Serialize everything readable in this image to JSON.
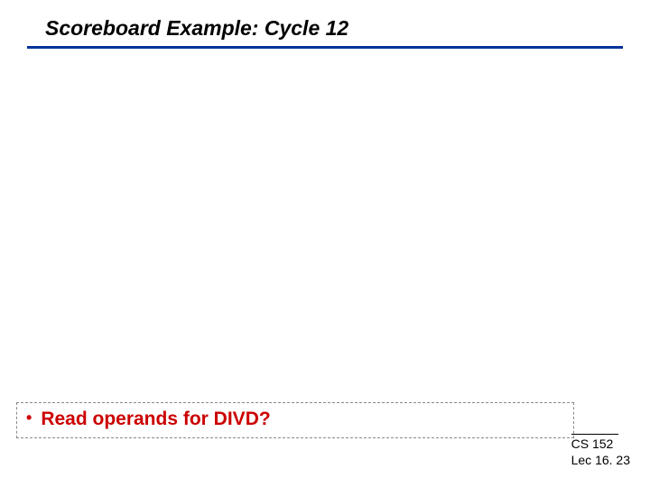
{
  "header": {
    "title": "Scoreboard Example: Cycle 12"
  },
  "bullet": {
    "marker": "•",
    "text": "Read operands for DIVD?"
  },
  "footer": {
    "course": "CS 152",
    "lecture": "Lec 16. 23"
  },
  "colors": {
    "accent_red": "#cc0000",
    "underline_blue": "#003399"
  }
}
